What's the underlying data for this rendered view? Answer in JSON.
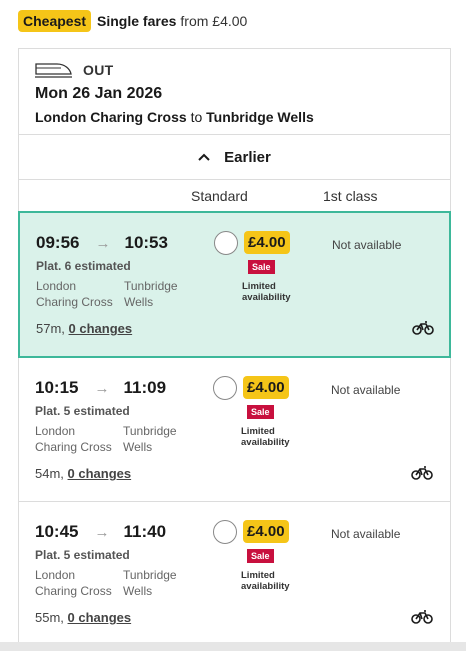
{
  "top": {
    "badge": "Cheapest",
    "title": "Single fares",
    "from_text": "from £4.00"
  },
  "journey": {
    "direction": "OUT",
    "date": "Mon 26 Jan 2026",
    "origin": "London Charing Cross",
    "connector": "to",
    "destination": "Tunbridge Wells"
  },
  "earlier_label": "Earlier",
  "columns": {
    "standard": "Standard",
    "first": "1st class"
  },
  "trains": [
    {
      "depart": "09:56",
      "arrive": "10:53",
      "platform": "Plat. 6 estimated",
      "from_line1": "London",
      "from_line2": "Charing Cross",
      "to_line1": "Tunbridge",
      "to_line2": "Wells",
      "duration": "57m,",
      "changes": "0 changes",
      "price": "£4.00",
      "sale": "Sale",
      "limited_line1": "Limited",
      "limited_line2": "availability",
      "first_class": "Not available",
      "selected": true
    },
    {
      "depart": "10:15",
      "arrive": "11:09",
      "platform": "Plat. 5 estimated",
      "from_line1": "London",
      "from_line2": "Charing Cross",
      "to_line1": "Tunbridge",
      "to_line2": "Wells",
      "duration": "54m,",
      "changes": "0 changes",
      "price": "£4.00",
      "sale": "Sale",
      "limited_line1": "Limited",
      "limited_line2": "availability",
      "first_class": "Not available",
      "selected": false
    },
    {
      "depart": "10:45",
      "arrive": "11:40",
      "platform": "Plat. 5 estimated",
      "from_line1": "London",
      "from_line2": "Charing Cross",
      "to_line1": "Tunbridge",
      "to_line2": "Wells",
      "duration": "55m,",
      "changes": "0 changes",
      "price": "£4.00",
      "sale": "Sale",
      "limited_line1": "Limited",
      "limited_line2": "availability",
      "first_class": "Not available",
      "selected": false
    }
  ],
  "colors": {
    "accent_yellow": "#f5c518",
    "sale_red": "#c8103e",
    "selected_bg": "#daf2ea",
    "selected_border": "#3db89a"
  },
  "icons": {
    "train": "train-icon",
    "chevron": "chevron-up-icon",
    "bike": "bicycle-icon"
  }
}
